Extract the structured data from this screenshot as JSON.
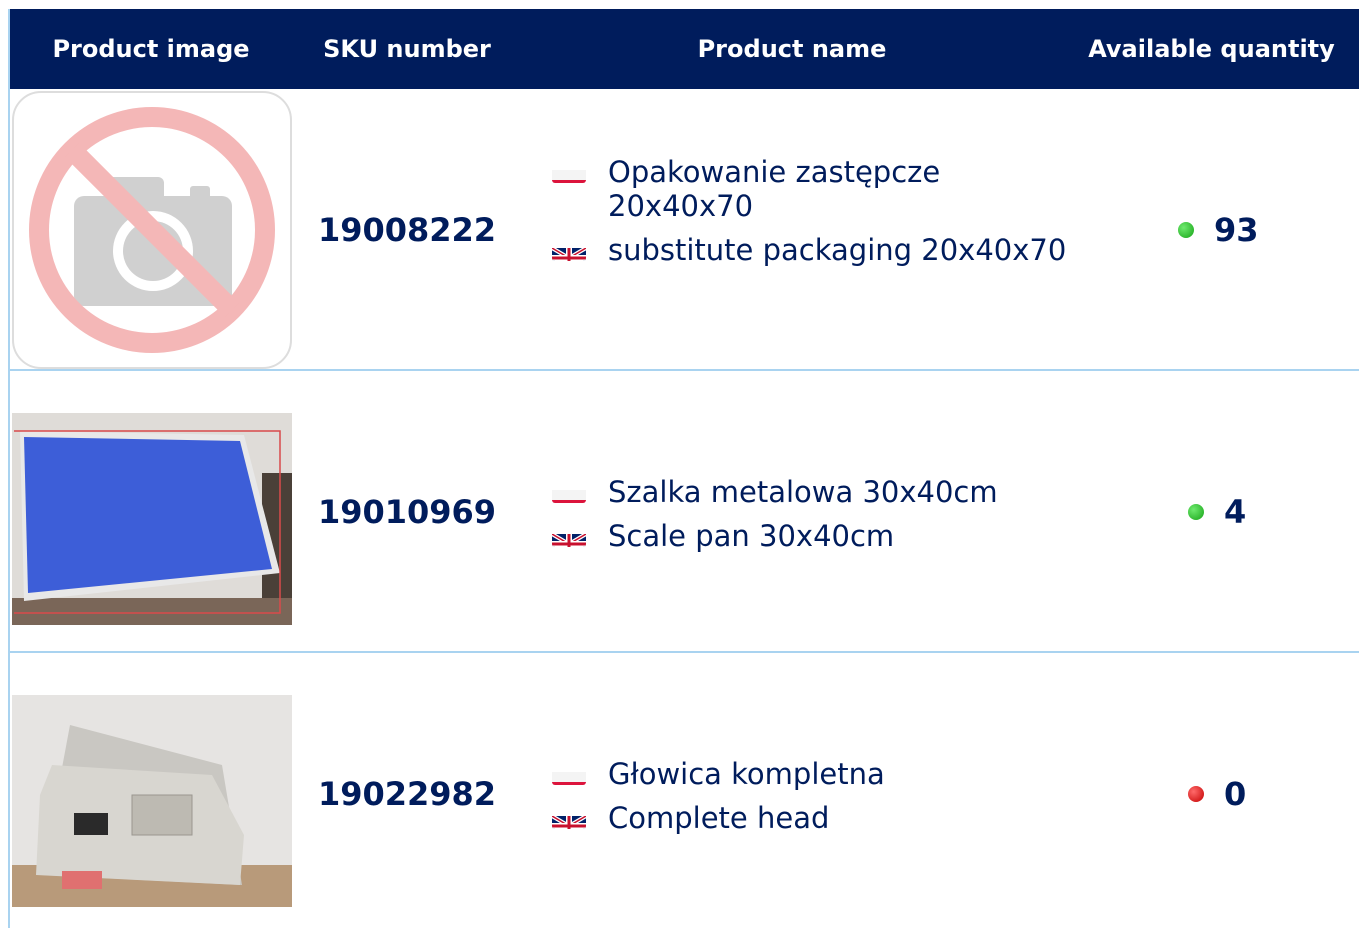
{
  "table": {
    "headers": {
      "image": "Product image",
      "sku": "SKU number",
      "name": "Product name",
      "quantity": "Available quantity"
    },
    "rows": [
      {
        "sku": "19008222",
        "name_pl": "Opakowanie zastępcze 20x40x70",
        "name_en": "substitute packaging 20x40x70",
        "quantity": "93",
        "status": "in-stock",
        "image": "no-photo-icon"
      },
      {
        "sku": "19010969",
        "name_pl": "Szalka metalowa 30x40cm",
        "name_en": "Scale pan 30x40cm",
        "quantity": "4",
        "status": "in-stock",
        "image": "scale-pan-photo"
      },
      {
        "sku": "19022982",
        "name_pl": "Głowica kompletna",
        "name_en": "Complete head",
        "quantity": "0",
        "status": "out-of-stock",
        "image": "scale-head-photo"
      }
    ]
  },
  "colors": {
    "header_bg": "#001c5c",
    "text": "#001c5c",
    "border": "#a9d3f0",
    "in_stock": "#17a317",
    "out_of_stock": "#c40000"
  }
}
